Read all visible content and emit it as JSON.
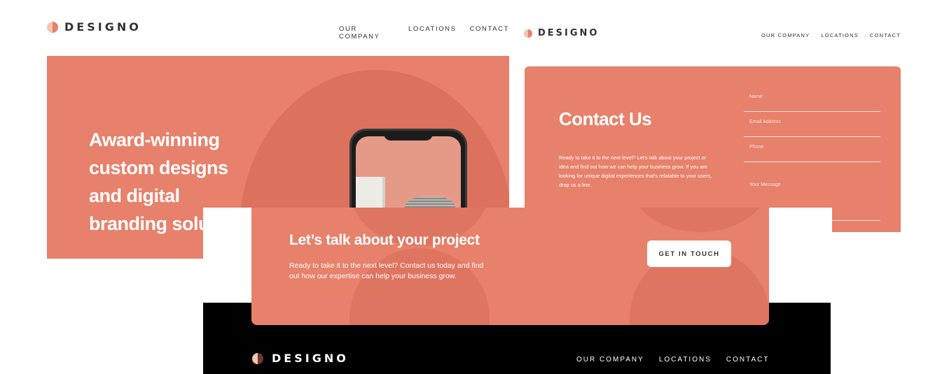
{
  "hero_page": {
    "logo_text": "DESIGNO",
    "nav": [
      "OUR COMPANY",
      "LOCATIONS",
      "CONTACT"
    ],
    "heading": "Award-winning custom designs and digital branding solutions"
  },
  "contact_page": {
    "logo_text": "DESIGNO",
    "nav": [
      "OUR COMPANY",
      "LOCATIONS",
      "CONTACT"
    ],
    "title": "Contact Us",
    "body": "Ready to take it to the next level? Let's talk about your project or idea and find out how we can help your business grow. If you are looking for unique digital experiences that's relatable to your users, drop us a line.",
    "fields": {
      "name": "Name",
      "email": "Email Address",
      "phone": "Phone",
      "message": "Your Message"
    }
  },
  "cta_page": {
    "title": "Let’s talk about your project",
    "body": "Ready to take it to the next level? Contact us today and find out how our expertise can help your business grow.",
    "button": "GET IN TOUCH"
  },
  "footer": {
    "logo_text": "DESIGNO",
    "nav": [
      "OUR COMPANY",
      "LOCATIONS",
      "CONTACT"
    ]
  },
  "colors": {
    "peach": "#e7816b",
    "dark": "#333136",
    "footer_bg": "#000000"
  },
  "icons": [
    "logo-mark-icon"
  ]
}
